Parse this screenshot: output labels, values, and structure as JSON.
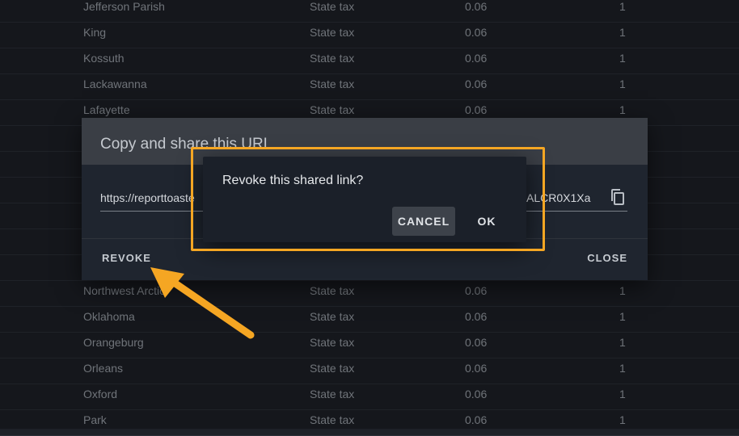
{
  "table": {
    "rows_top": [
      {
        "name": "Jefferson Parish",
        "type": "State tax",
        "rate": "0.06",
        "count": "1"
      },
      {
        "name": "King",
        "type": "State tax",
        "rate": "0.06",
        "count": "1"
      },
      {
        "name": "Kossuth",
        "type": "State tax",
        "rate": "0.06",
        "count": "1"
      },
      {
        "name": "Lackawanna",
        "type": "State tax",
        "rate": "0.06",
        "count": "1"
      },
      {
        "name": "Lafayette",
        "type": "State tax",
        "rate": "0.06",
        "count": "1"
      }
    ],
    "rows_bottom": [
      {
        "name": "Northwest Arctic",
        "type": "State tax",
        "rate": "0.06",
        "count": "1"
      },
      {
        "name": "Oklahoma",
        "type": "State tax",
        "rate": "0.06",
        "count": "1"
      },
      {
        "name": "Orangeburg",
        "type": "State tax",
        "rate": "0.06",
        "count": "1"
      },
      {
        "name": "Orleans",
        "type": "State tax",
        "rate": "0.06",
        "count": "1"
      },
      {
        "name": "Oxford",
        "type": "State tax",
        "rate": "0.06",
        "count": "1"
      },
      {
        "name": "Park",
        "type": "State tax",
        "rate": "0.06",
        "count": "1"
      }
    ]
  },
  "share_dialog": {
    "title": "Copy and share this URL",
    "url_start": "https://reporttoaste",
    "url_end": "ALCR0X1Xa",
    "copy_icon": "copy-icon",
    "revoke_label": "REVOKE",
    "close_label": "CLOSE"
  },
  "confirm_dialog": {
    "message": "Revoke this shared link?",
    "cancel_label": "CANCEL",
    "ok_label": "OK"
  },
  "colors": {
    "highlight": "#f5a623",
    "arrow": "#f5a623"
  }
}
